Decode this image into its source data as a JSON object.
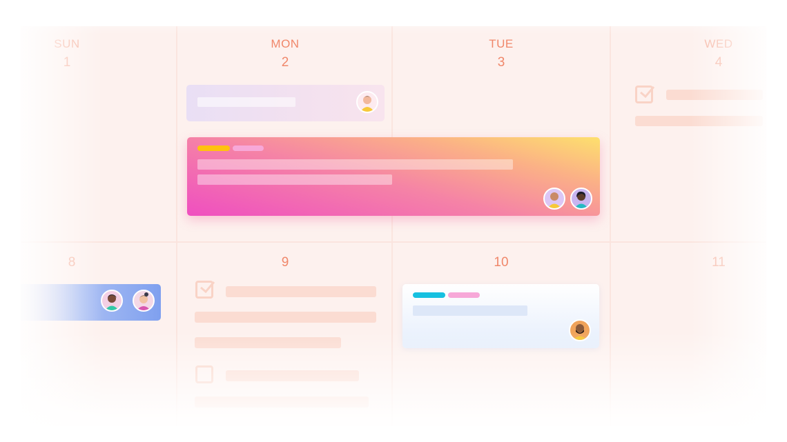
{
  "calendar": {
    "days": [
      {
        "name": "SUN",
        "number": "1"
      },
      {
        "name": "MON",
        "number": "2"
      },
      {
        "name": "TUE",
        "number": "3"
      },
      {
        "name": "WED",
        "number": "4"
      }
    ],
    "week2": [
      {
        "number": "8"
      },
      {
        "number": "9"
      },
      {
        "number": "10"
      },
      {
        "number": "11"
      }
    ]
  },
  "colors": {
    "grid_background": "#fdf1ee",
    "day_label": "#f0876a",
    "featured_event_gradient": [
      "#fcd86c",
      "#f48aa8",
      "#ef4fc0"
    ],
    "tag_yellow": "#ffc20e",
    "tag_pink": "#f7a8d8",
    "tag_cyan": "#16c0e0",
    "blue_event": "#7fa0ef"
  },
  "events": [
    {
      "id": "mon-event",
      "day": "MON 2",
      "avatars": [
        "person-avatar"
      ]
    },
    {
      "id": "featured-event",
      "span": "MON 2 – TUE 3",
      "avatars": [
        "person-avatar",
        "person-avatar"
      ]
    },
    {
      "id": "sun8-event",
      "day": "SUN 8",
      "avatars": [
        "person-avatar",
        "person-avatar"
      ]
    },
    {
      "id": "tue10-event",
      "day": "TUE 10",
      "avatars": [
        "person-avatar"
      ]
    }
  ]
}
